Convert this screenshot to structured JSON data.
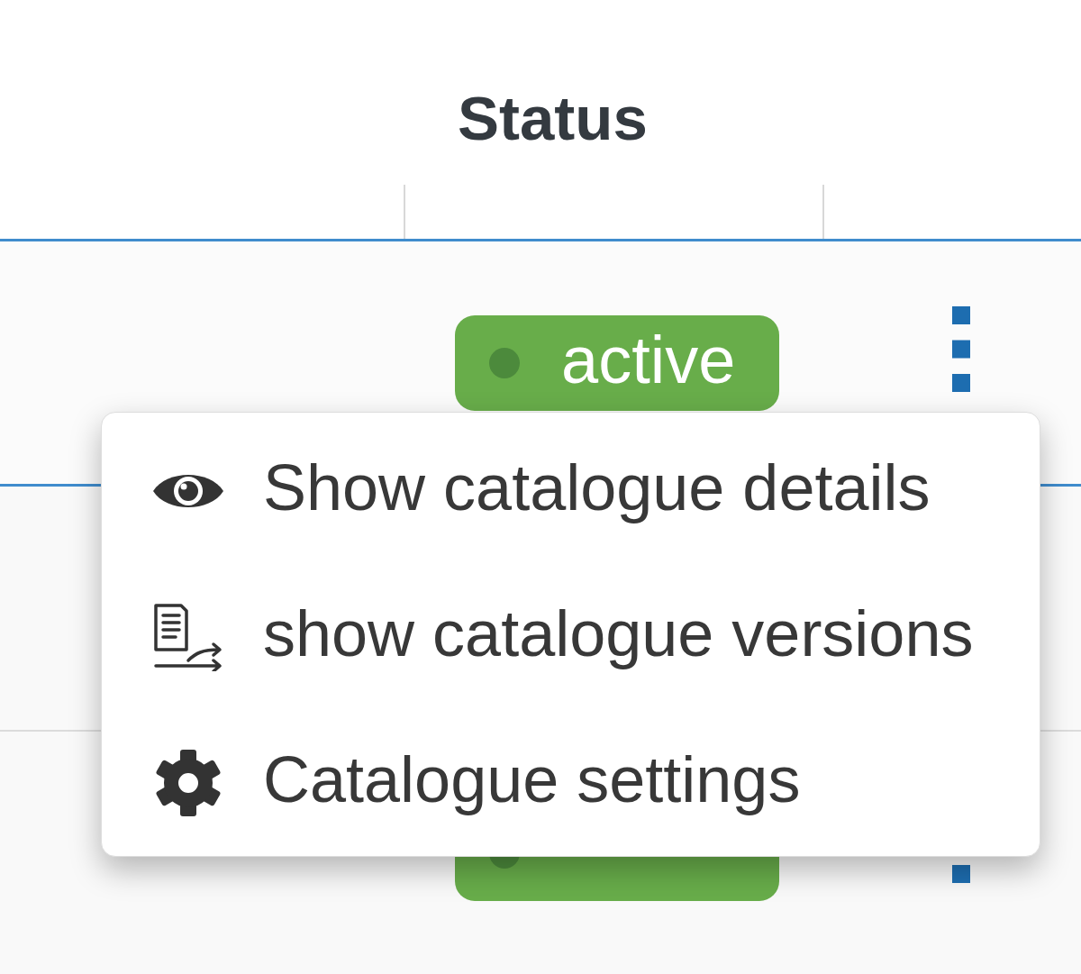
{
  "table": {
    "status_heading": "Status",
    "rows": [
      {
        "selected": true,
        "badge": true,
        "status": "active",
        "menu_button": true
      },
      {
        "selected": false
      },
      {
        "selected": false,
        "badge": true,
        "menu_button": true
      }
    ]
  },
  "context_menu": {
    "items": [
      {
        "label": "Show catalogue details"
      },
      {
        "label": "show catalogue versions"
      },
      {
        "label": "Catalogue settings"
      }
    ]
  }
}
